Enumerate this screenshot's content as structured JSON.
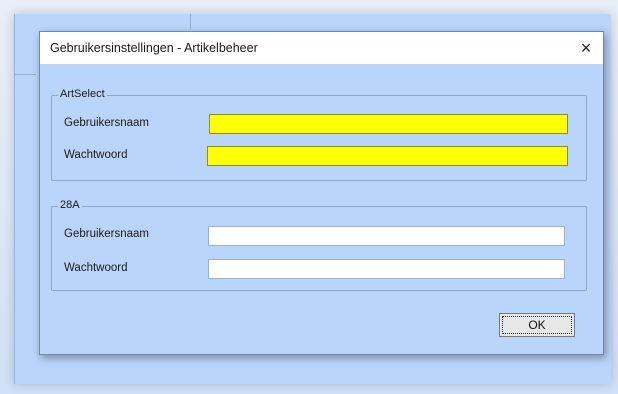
{
  "dialog": {
    "title": "Gebruikersinstellingen - Artikelbeheer",
    "close_glyph": "×",
    "close_icon": "close-icon"
  },
  "groups": [
    {
      "label": "ArtSelect",
      "username_label": "Gebruikersnaam",
      "username_value": "",
      "password_label": "Wachtwoord",
      "password_value": "",
      "highlight_color": "#ffff00"
    },
    {
      "label": "28A",
      "username_label": "Gebruikersnaam",
      "username_value": "",
      "password_label": "Wachtwoord",
      "password_value": ""
    }
  ],
  "buttons": {
    "ok_label": "OK"
  },
  "colors": {
    "dialog_background": "#b9d5fb",
    "highlight": "#ffff00"
  }
}
